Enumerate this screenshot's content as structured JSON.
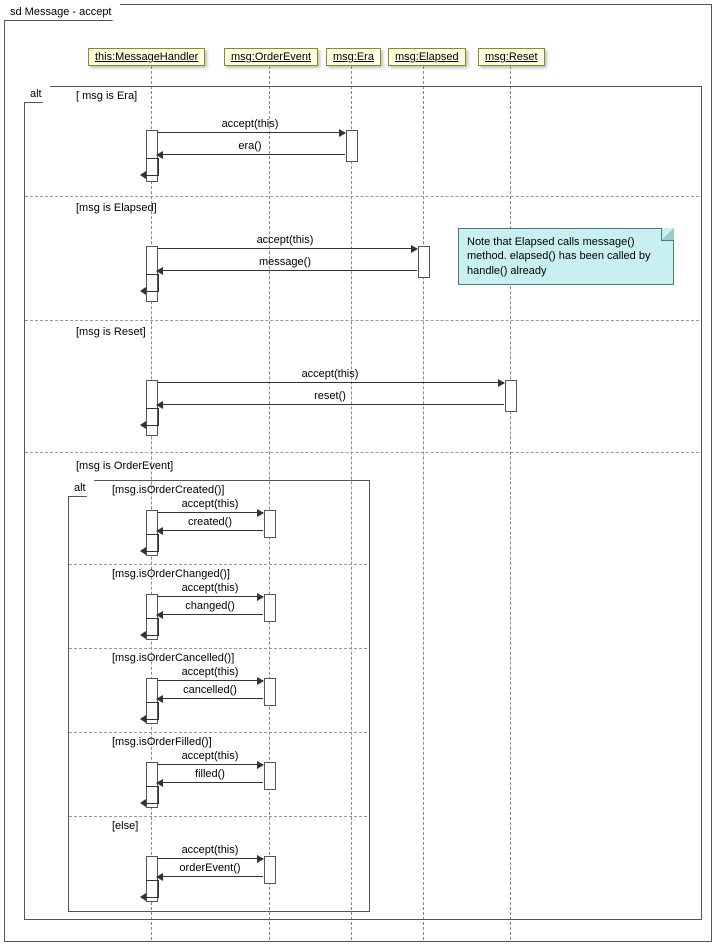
{
  "outerFrame": {
    "label": "sd Message - accept"
  },
  "lifelines": [
    {
      "name": "this:MessageHandler"
    },
    {
      "name": "msg:OrderEvent"
    },
    {
      "name": "msg:Era"
    },
    {
      "name": "msg:Elapsed"
    },
    {
      "name": "msg:Reset"
    }
  ],
  "altFrame": {
    "label": "alt"
  },
  "sections": [
    {
      "guard": "[ msg is Era]",
      "calls": [
        {
          "fwd": "accept(this)",
          "ret": "era()"
        }
      ]
    },
    {
      "guard": "[msg is Elapsed]",
      "calls": [
        {
          "fwd": "accept(this)",
          "ret": "message()"
        }
      ],
      "note": "Note that Elapsed calls message() method. elapsed() has been called by handle() already"
    },
    {
      "guard": "[msg is Reset]",
      "calls": [
        {
          "fwd": "accept(this)",
          "ret": "reset()"
        }
      ]
    },
    {
      "guard": "[msg is OrderEvent]"
    }
  ],
  "innerAlt": {
    "label": "alt"
  },
  "innerSections": [
    {
      "guard": "[msg.isOrderCreated()]",
      "fwd": "accept(this)",
      "ret": "created()"
    },
    {
      "guard": "[msg.isOrderChanged()]",
      "fwd": "accept(this)",
      "ret": "changed()"
    },
    {
      "guard": "[msg.isOrderCancelled()]",
      "fwd": "accept(this)",
      "ret": "cancelled()"
    },
    {
      "guard": "[msg.isOrderFilled()]",
      "fwd": "accept(this)",
      "ret": "filled()"
    },
    {
      "guard": "[else]",
      "fwd": "accept(this)",
      "ret": "orderEvent()"
    }
  ]
}
